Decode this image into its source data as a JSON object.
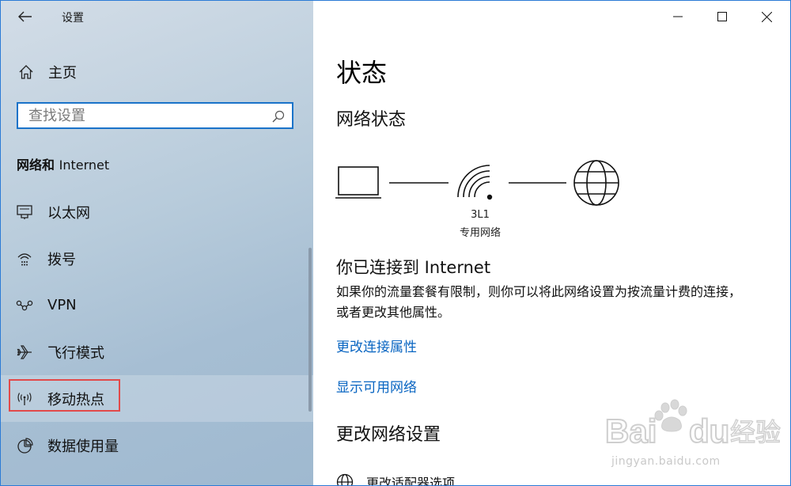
{
  "window": {
    "title": "设置",
    "controls": {
      "minimize": "minimize",
      "maximize": "maximize",
      "close": "close"
    }
  },
  "sidebar": {
    "home_label": "主页",
    "search_placeholder": "查找设置",
    "section_title_cn": "网络和",
    "section_title_en": "Internet",
    "items": [
      {
        "label": "以太网",
        "icon": "ethernet-icon"
      },
      {
        "label": "拨号",
        "icon": "dialup-icon"
      },
      {
        "label": "VPN",
        "icon": "vpn-icon"
      },
      {
        "label": "飞行模式",
        "icon": "airplane-icon"
      },
      {
        "label": "移动热点",
        "icon": "hotspot-icon",
        "selected": true
      },
      {
        "label": "数据使用量",
        "icon": "data-usage-icon"
      }
    ],
    "highlight_color": "#e24a4a"
  },
  "main": {
    "title": "状态",
    "network_status_heading": "网络状态",
    "network_name": "3L1",
    "network_type": "专用网络",
    "connected_title": "你已连接到 Internet",
    "connected_desc": "如果你的流量套餐有限制，则你可以将此网络设置为按流量计费的连接，或者更改其他属性。",
    "link_change_props": "更改连接属性",
    "link_show_networks": "显示可用网络",
    "change_settings_heading": "更改网络设置",
    "adapter_option": "更改适配器选项",
    "link_color": "#0a66c2",
    "accent_color": "#1a73c9"
  },
  "watermark": {
    "brand": "Bai du 经验",
    "url": "jingyan.baidu.com"
  }
}
